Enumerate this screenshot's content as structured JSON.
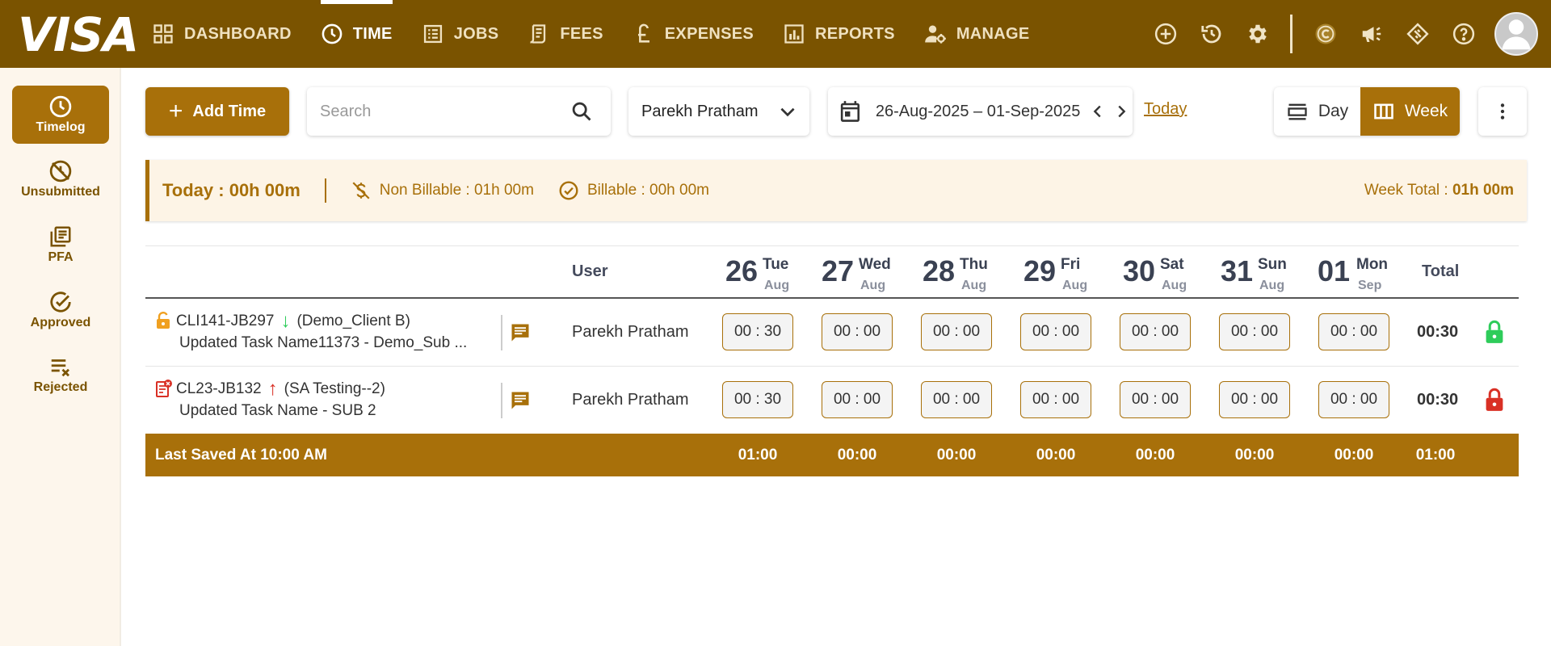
{
  "brand": {
    "logo_text": "VISA"
  },
  "nav": [
    {
      "label": "DASHBOARD",
      "icon": "dashboard-icon",
      "active": false
    },
    {
      "label": "TIME",
      "icon": "clock-icon",
      "active": true
    },
    {
      "label": "JOBS",
      "icon": "jobs-icon",
      "active": false
    },
    {
      "label": "FEES",
      "icon": "fees-icon",
      "active": false
    },
    {
      "label": "EXPENSES",
      "icon": "pound-icon",
      "active": false
    },
    {
      "label": "REPORTS",
      "icon": "reports-icon",
      "active": false
    },
    {
      "label": "MANAGE",
      "icon": "manage-icon",
      "active": false
    }
  ],
  "top_actions": [
    "add-circle-icon",
    "history-icon",
    "gear-icon",
    "currency-icon",
    "megaphone-icon",
    "ticket-icon",
    "help-icon",
    "avatar"
  ],
  "sidebar": {
    "items": [
      {
        "label": "Timelog",
        "icon": "clock-icon",
        "active": true
      },
      {
        "label": "Unsubmitted",
        "icon": "unsubmitted-icon",
        "active": false
      },
      {
        "label": "PFA",
        "icon": "pfa-icon",
        "active": false
      },
      {
        "label": "Approved",
        "icon": "approved-icon",
        "active": false
      },
      {
        "label": "Rejected",
        "icon": "rejected-icon",
        "active": false
      }
    ]
  },
  "toolbar": {
    "add_time_label": "Add Time",
    "search_placeholder": "Search",
    "selected_user": "Parekh Pratham",
    "date_range": "26-Aug-2025 – 01-Sep-2025",
    "today_label": "Today",
    "view_day_label": "Day",
    "view_week_label": "Week",
    "active_view": "Week"
  },
  "summary": {
    "today": "Today : 00h 00m",
    "non_billable": "Non Billable : 01h 00m",
    "billable": "Billable : 00h 00m",
    "week_total_label": "Week Total : ",
    "week_total_value": "01h 00m"
  },
  "table": {
    "user_header": "User",
    "total_header": "Total",
    "days": [
      {
        "num": "26",
        "name": "Tue",
        "month": "Aug"
      },
      {
        "num": "27",
        "name": "Wed",
        "month": "Aug"
      },
      {
        "num": "28",
        "name": "Thu",
        "month": "Aug"
      },
      {
        "num": "29",
        "name": "Fri",
        "month": "Aug"
      },
      {
        "num": "30",
        "name": "Sat",
        "month": "Aug"
      },
      {
        "num": "31",
        "name": "Sun",
        "month": "Aug"
      },
      {
        "num": "01",
        "name": "Mon",
        "month": "Sep"
      }
    ],
    "rows": [
      {
        "status_icon": "unlocked-badge-icon",
        "job_code": "CLI141-JB297",
        "direction": "↓",
        "client": "(Demo_Client B)",
        "task": "Updated Task Name11373 - Demo_Sub ...",
        "user": "Parekh Pratham",
        "times": [
          "00 : 30",
          "00 : 00",
          "00 : 00",
          "00 : 00",
          "00 : 00",
          "00 : 00",
          "00 : 00"
        ],
        "total": "00:30",
        "lock_state": "unlocked",
        "lock_color": "#2ecc5a"
      },
      {
        "status_icon": "rejected-doc-icon",
        "job_code": "CL23-JB132",
        "direction": "↑",
        "client": "(SA Testing--2)",
        "task": "Updated Task Name - SUB 2",
        "user": "Parekh Pratham",
        "times": [
          "00 : 30",
          "00 : 00",
          "00 : 00",
          "00 : 00",
          "00 : 00",
          "00 : 00",
          "00 : 00"
        ],
        "total": "00:30",
        "lock_state": "locked",
        "lock_color": "#d93025"
      }
    ],
    "footer": {
      "label": "Last Saved At 10:00 AM",
      "totals": [
        "01:00",
        "00:00",
        "00:00",
        "00:00",
        "00:00",
        "00:00",
        "00:00"
      ],
      "grand_total": "01:00"
    }
  },
  "colors": {
    "topbar": "#7a5300",
    "accent": "#a8700a",
    "sidebar_bg": "#fdf6ec",
    "summary_bg": "#fdf4e6",
    "direction_down": "#2ecc5a",
    "direction_up": "#d93025"
  }
}
